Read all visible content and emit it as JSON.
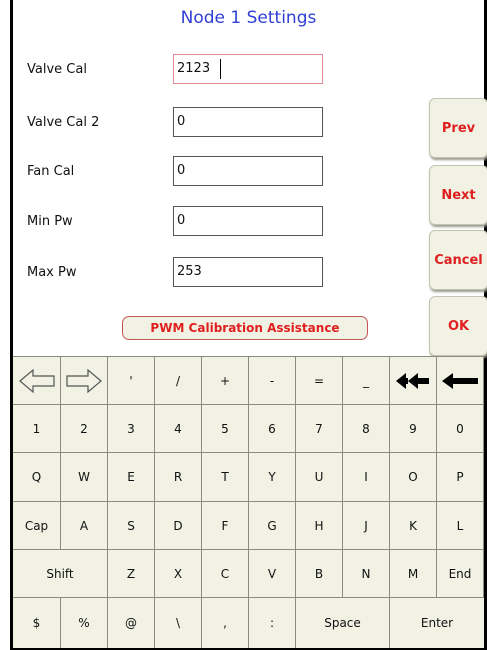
{
  "title": "Node 1 Settings",
  "fields": [
    {
      "label": "Valve Cal",
      "value": "2123"
    },
    {
      "label": "Valve Cal 2",
      "value": "0"
    },
    {
      "label": "Fan Cal",
      "value": "0"
    },
    {
      "label": "Min Pw",
      "value": "0"
    },
    {
      "label": "Max Pw",
      "value": "253"
    }
  ],
  "side_buttons": {
    "prev": "Prev",
    "next": "Next",
    "cancel": "Cancel",
    "ok": "OK"
  },
  "pwm_button": "PWM Calibration Assistance",
  "colors": {
    "title": "#2f3fd6",
    "button_text": "#e02020",
    "key_face": "#f1f1e4"
  },
  "keyboard": {
    "row0": [
      "left-arrow-icon",
      "right-arrow-icon",
      "'",
      "/",
      "+",
      "-",
      "=",
      "_",
      "double-backspace-icon",
      "backspace-icon"
    ],
    "row1": [
      "1",
      "2",
      "3",
      "4",
      "5",
      "6",
      "7",
      "8",
      "9",
      "0"
    ],
    "row2": [
      "Q",
      "W",
      "E",
      "R",
      "T",
      "Y",
      "U",
      "I",
      "O",
      "P"
    ],
    "row3": [
      "Cap",
      "A",
      "S",
      "D",
      "F",
      "G",
      "H",
      "J",
      "K",
      "L"
    ],
    "row4": [
      "Shift",
      "Z",
      "X",
      "C",
      "V",
      "B",
      "N",
      "M",
      "End"
    ],
    "row5": [
      "$",
      "%",
      "@",
      "\\",
      ",",
      ":",
      "Space",
      "Enter"
    ]
  }
}
